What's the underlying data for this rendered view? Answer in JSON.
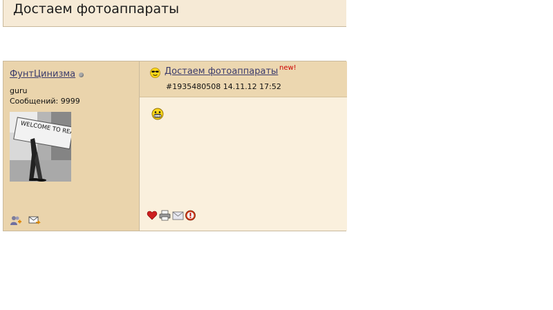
{
  "topic": {
    "title": "Достаем фотоаппараты"
  },
  "post": {
    "author": {
      "name": "ФунтЦинизма",
      "rank": "guru",
      "posts_label": "Сообщений: 9999",
      "avatar_text": "WELCOME TO REALITY"
    },
    "title": "Достаем фотоаппараты",
    "new_label": "new!",
    "meta": "#1935480508 14.11.12 17:52",
    "colors": {
      "link": "#3b3b6b",
      "new": "#cc0000",
      "author_bg": "#ead4ac",
      "post_bg": "#faf0dd"
    },
    "author_actions": [
      {
        "icon": "add-friend-icon"
      },
      {
        "icon": "private-message-icon"
      }
    ],
    "post_actions": [
      {
        "icon": "heart-icon"
      },
      {
        "icon": "print-icon"
      },
      {
        "icon": "email-icon"
      },
      {
        "icon": "report-icon"
      }
    ]
  }
}
